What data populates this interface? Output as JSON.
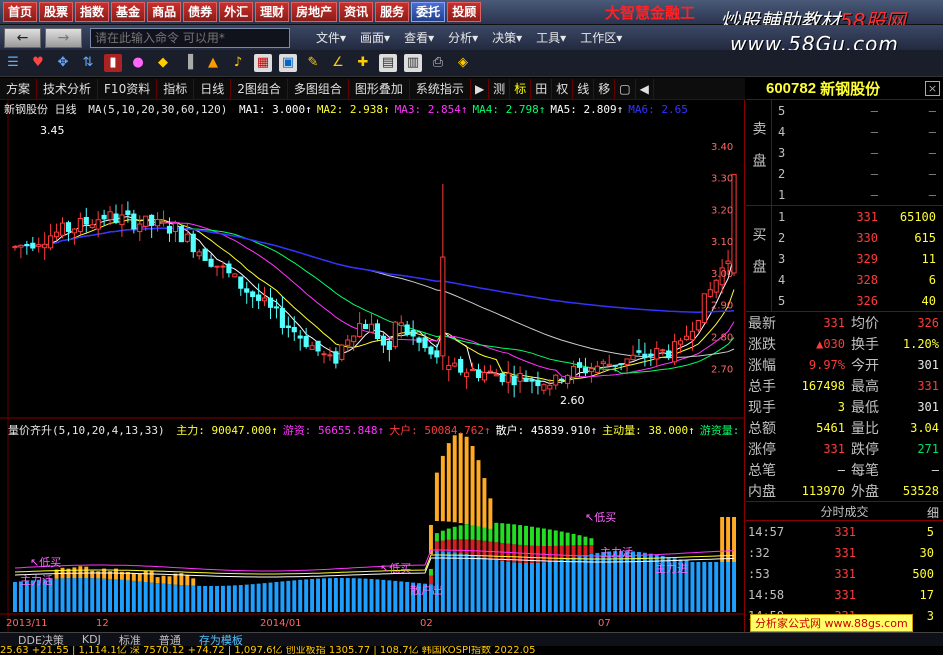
{
  "top_nav": {
    "items": [
      "首页",
      "股票",
      "指数",
      "基金",
      "商品",
      "债券",
      "外汇",
      "理财",
      "房地产",
      "资讯",
      "服务",
      "委托",
      "投顾"
    ],
    "brand": "大智慧金融工",
    "watermark_cn": "炒股輔助教材",
    "watermark_brand": "58股网",
    "watermark_url": "www.58Gu.com"
  },
  "menubar": {
    "back": "←",
    "forward": "→",
    "command_placeholder": "请在此输入命令 可以用*",
    "menus": [
      "文件▾",
      "画面▾",
      "查看▾",
      "分析▾",
      "决策▾",
      "工具▾",
      "工作区▾"
    ]
  },
  "toolbar": {
    "icons": [
      "list-icon",
      "heart-icon",
      "move-icon",
      "zoom-icon",
      "mark-icon",
      "color-icon",
      "diamond-icon",
      "bar-icon",
      "mountain-icon",
      "bell-icon",
      "chart-icon",
      "picture-icon",
      "pencil-icon",
      "angle-icon",
      "cross-icon",
      "grid-icon",
      "table-icon",
      "print-icon",
      "diamond-icon"
    ]
  },
  "tabs": {
    "items": [
      "方案",
      "技术分析",
      "F10资料",
      "指标",
      "日线",
      "2图组合",
      "多图组合",
      "图形叠加",
      "系统指示",
      "▶",
      "测",
      "标",
      "田",
      "权",
      "线",
      "移",
      "▢",
      "◀"
    ]
  },
  "main_chart": {
    "title": "新钢股份 日线",
    "ma_label": "MA(5,10,20,30,60,120)",
    "ma_values": [
      {
        "name": "MA1",
        "value": "3.000↑",
        "color": "#ffffff"
      },
      {
        "name": "MA2",
        "value": "2.938↑",
        "color": "#ffff33"
      },
      {
        "name": "MA3",
        "value": "2.854↑",
        "color": "#ff33ff"
      },
      {
        "name": "MA4",
        "value": "2.798↑",
        "color": "#00ff66"
      },
      {
        "name": "MA5",
        "value": "2.809↑",
        "color": "#ffffff"
      },
      {
        "name": "MA6",
        "value": "2.65",
        "color": "#3333ff"
      }
    ],
    "high_label": "3.45",
    "low_label": "2.60",
    "y_ticks": [
      "3.40",
      "3.30",
      "3.20",
      "3.10",
      "3.00",
      "2.90",
      "2.80",
      "2.70"
    ]
  },
  "indicator": {
    "label": "量价齐升(5,10,20,4,13,33)",
    "values": [
      {
        "name": "主力",
        "value": "90047.000↑",
        "color": "#ffff33"
      },
      {
        "name": "游资",
        "value": "56655.848↑",
        "color": "#ff33ff"
      },
      {
        "name": "大户",
        "value": "50084.762↑",
        "color": "#ff3b3b"
      },
      {
        "name": "散户",
        "value": "45839.910↑",
        "color": "#ffffff"
      },
      {
        "name": "主动量",
        "value": "38.000↑",
        "color": "#ffff33"
      },
      {
        "name": "游资量",
        "value": "",
        "color": "#00ff66"
      }
    ],
    "annotations": [
      "↖低买",
      "↖低买",
      "↖低买",
      "主力活",
      "主力活",
      "散户出",
      "主力进"
    ]
  },
  "date_axis": [
    "2013/11",
    "12",
    "2014/01",
    "02",
    "07"
  ],
  "stock": {
    "code": "600782",
    "name": "新钢股份",
    "close_label": "×"
  },
  "order_book": {
    "sell_label": "卖盘",
    "buy_label": "买盘",
    "sell": [
      {
        "level": "5",
        "price": "–",
        "vol": "–"
      },
      {
        "level": "4",
        "price": "–",
        "vol": "–"
      },
      {
        "level": "3",
        "price": "–",
        "vol": "–"
      },
      {
        "level": "2",
        "price": "–",
        "vol": "–"
      },
      {
        "level": "1",
        "price": "–",
        "vol": "–"
      }
    ],
    "buy": [
      {
        "level": "1",
        "price": "331",
        "vol": "65100"
      },
      {
        "level": "2",
        "price": "330",
        "vol": "615"
      },
      {
        "level": "3",
        "price": "329",
        "vol": "11"
      },
      {
        "level": "4",
        "price": "328",
        "vol": "6"
      },
      {
        "level": "5",
        "price": "326",
        "vol": "40"
      }
    ]
  },
  "quote": [
    {
      "l1": "最新",
      "v1": "331",
      "c1": "red",
      "l2": "均价",
      "v2": "326",
      "c2": "red"
    },
    {
      "l1": "涨跌",
      "v1": "▲030",
      "c1": "red",
      "l2": "换手",
      "v2": "1.20%",
      "c2": "yel"
    },
    {
      "l1": "涨幅",
      "v1": "9.97%",
      "c1": "red",
      "l2": "今开",
      "v2": "301",
      "c2": "wht"
    },
    {
      "l1": "总手",
      "v1": "167498",
      "c1": "yel",
      "l2": "最高",
      "v2": "331",
      "c2": "red"
    },
    {
      "l1": "现手",
      "v1": "3",
      "c1": "yel",
      "l2": "最低",
      "v2": "301",
      "c2": "wht"
    },
    {
      "l1": "总额",
      "v1": "5461",
      "c1": "yel",
      "l2": "量比",
      "v2": "3.04",
      "c2": "yel"
    },
    {
      "l1": "涨停",
      "v1": "331",
      "c1": "red",
      "l2": "跌停",
      "v2": "271",
      "c2": "grn"
    },
    {
      "l1": "总笔",
      "v1": "–",
      "c1": "wht",
      "l2": "每笔",
      "v2": "–",
      "c2": "wht"
    },
    {
      "l1": "内盘",
      "v1": "113970",
      "c1": "yel",
      "l2": "外盘",
      "v2": "53528",
      "c2": "yel"
    }
  ],
  "trades": {
    "title": "分时成交",
    "detail": "细",
    "rows": [
      {
        "time": "14:57",
        "price": "331",
        "vol": "5"
      },
      {
        "time": ":32",
        "price": "331",
        "vol": "30"
      },
      {
        "time": ":53",
        "price": "331",
        "vol": "500"
      },
      {
        "time": "14:58",
        "price": "331",
        "vol": "17"
      },
      {
        "time": "14:59",
        "price": "331",
        "vol": "3"
      }
    ]
  },
  "bottom_tabs": [
    "DDE决策",
    "KDJ",
    "标准",
    "普通",
    "存为模板"
  ],
  "footer_watermark": "分析家公式网 www.88gs.com",
  "ticker": "25.63 +21.55 | 1,114.1亿 深 7570.12 +74.72 | 1,097.6亿 创业板指 1305.77 | 108.7亿 韩国KOSPI指数 2022.05"
}
